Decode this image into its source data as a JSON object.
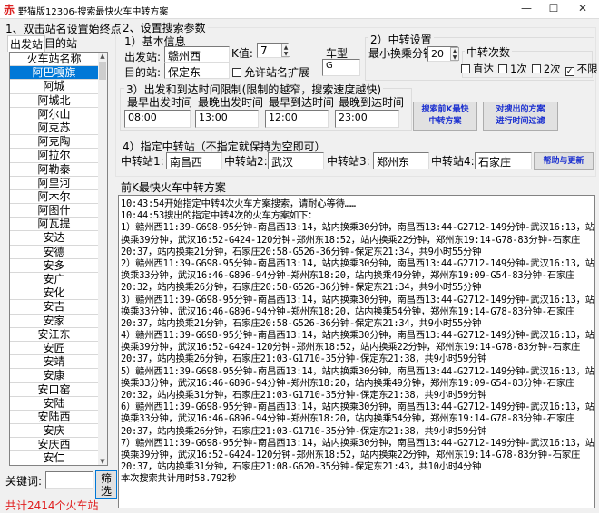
{
  "window": {
    "title": "野猫版12306-搜索最快火车中转方案",
    "logo": "赤",
    "minimize": "—",
    "maximize": "☐",
    "close": "✕"
  },
  "left": {
    "section_title": "1、双击站名设置始终点",
    "tabs": [
      "出发站",
      "目的站"
    ],
    "list_header": "火车站名称",
    "stations": [
      "阿巴嘎旗",
      "阿城",
      "阿城北",
      "阿尔山",
      "阿克苏",
      "阿克陶",
      "阿拉尔",
      "阿勒泰",
      "阿里河",
      "阿木尔",
      "阿图什",
      "阿瓦提",
      "安达",
      "安德",
      "安多",
      "安广",
      "安化",
      "安吉",
      "安家",
      "安江东",
      "安匠",
      "安靖",
      "安康",
      "安口窑",
      "安陆",
      "安陆西",
      "安庆",
      "安庆西",
      "安仁"
    ],
    "selected_index": 0,
    "keyword_label": "关键词:",
    "keyword_value": "",
    "filter_button": "筛选",
    "count_text": "共计2414个火车站",
    "count_color": "#e02020"
  },
  "params": {
    "section_title": "2、设置搜索参数",
    "basic": {
      "title": "1）基本信息",
      "from_label": "出发站:",
      "from_value": "赣州西",
      "to_label": "目的站:",
      "to_value": "保定东",
      "k_label": "K值:",
      "k_value": "7",
      "expand_label": "允许站名扩展",
      "expand_checked": false,
      "train_type_label": "车型",
      "train_type_value": "G"
    },
    "transfer": {
      "title": "2）中转设置",
      "min_label": "最小换乘分钟",
      "min_value": "20",
      "count_title": "中转次数",
      "options": [
        {
          "label": "直达",
          "checked": false
        },
        {
          "label": "1次",
          "checked": false
        },
        {
          "label": "2次",
          "checked": false
        },
        {
          "label": "不限",
          "checked": true
        }
      ]
    },
    "time": {
      "title": "3）出发和到达时间限制(限制的越窄，搜索速度越快)",
      "labels": [
        "最早出发时间",
        "最晚出发时间",
        "最早到达时间",
        "最晚到达时间"
      ],
      "values": [
        "08:00",
        "13:00",
        "12:00",
        "23:00"
      ]
    },
    "search_button": "搜索前K最快\n中转方案",
    "filter_button": "对搜出的方案\n进行时间过滤",
    "stations": {
      "title": "4）指定中转站（不指定就保持为空即可）",
      "labels": [
        "中转站1:",
        "中转站2:",
        "中转站3:",
        "中转站4:"
      ],
      "values": [
        "南昌西",
        "武汉",
        "郑州东",
        "石家庄"
      ]
    },
    "help_button": "帮助与更新"
  },
  "results": {
    "title": "前K最快火车中转方案",
    "lines": [
      "10:43:54开始指定中转4次火车方案搜索，请耐心等待……",
      "10:44:53搜出的指定中转4次的火车方案如下：",
      "1）赣州西11:39-G698-95分钟-南昌西13:14，站内换乘30分钟，南昌西13:44-G2712-149分钟-武汉16:13，站内",
      "换乘39分钟，武汉16:52-G424-120分钟-郑州东18:52，站内换乘22分钟，郑州东19:14-G78-83分钟-石家庄",
      "20:37，站内换乘21分钟，石家庄20:58-G526-36分钟-保定东21:34，共9小时55分钟",
      "2）赣州西11:39-G698-95分钟-南昌西13:14，站内换乘30分钟，南昌西13:44-G2712-149分钟-武汉16:13，站内",
      "换乘33分钟，武汉16:46-G896-94分钟-郑州东18:20，站内换乘49分钟，郑州东19:09-G54-83分钟-石家庄",
      "20:32，站内换乘26分钟，石家庄20:58-G526-36分钟-保定东21:34，共9小时55分钟",
      "3）赣州西11:39-G698-95分钟-南昌西13:14，站内换乘30分钟，南昌西13:44-G2712-149分钟-武汉16:13，站内",
      "换乘33分钟，武汉16:46-G896-94分钟-郑州东18:20，站内换乘54分钟，郑州东19:14-G78-83分钟-石家庄",
      "20:37，站内换乘21分钟，石家庄20:58-G526-36分钟-保定东21:34，共9小时55分钟",
      "4）赣州西11:39-G698-95分钟-南昌西13:14，站内换乘30分钟，南昌西13:44-G2712-149分钟-武汉16:13，站内",
      "换乘39分钟，武汉16:52-G424-120分钟-郑州东18:52，站内换乘22分钟，郑州东19:14-G78-83分钟-石家庄",
      "20:37，站内换乘26分钟，石家庄21:03-G1710-35分钟-保定东21:38，共9小时59分钟",
      "5）赣州西11:39-G698-95分钟-南昌西13:14，站内换乘30分钟，南昌西13:44-G2712-149分钟-武汉16:13，站内",
      "换乘33分钟，武汉16:46-G896-94分钟-郑州东18:20，站内换乘49分钟，郑州东19:09-G54-83分钟-石家庄",
      "20:32，站内换乘31分钟，石家庄21:03-G1710-35分钟-保定东21:38，共9小时59分钟",
      "6）赣州西11:39-G698-95分钟-南昌西13:14，站内换乘30分钟，南昌西13:44-G2712-149分钟-武汉16:13，站内",
      "换乘33分钟，武汉16:46-G896-94分钟-郑州东18:20，站内换乘54分钟，郑州东19:14-G78-83分钟-石家庄",
      "20:37，站内换乘26分钟，石家庄21:03-G1710-35分钟-保定东21:38，共9小时59分钟",
      "7）赣州西11:39-G698-95分钟-南昌西13:14，站内换乘30分钟，南昌西13:44-G2712-149分钟-武汉16:13，站内",
      "换乘39分钟，武汉16:52-G424-120分钟-郑州东18:52，站内换乘22分钟，郑州东19:14-G78-83分钟-石家庄",
      "20:37，站内换乘31分钟，石家庄21:08-G620-35分钟-保定东21:43，共10小时4分钟",
      "本次搜索共计用时58.792秒"
    ]
  }
}
